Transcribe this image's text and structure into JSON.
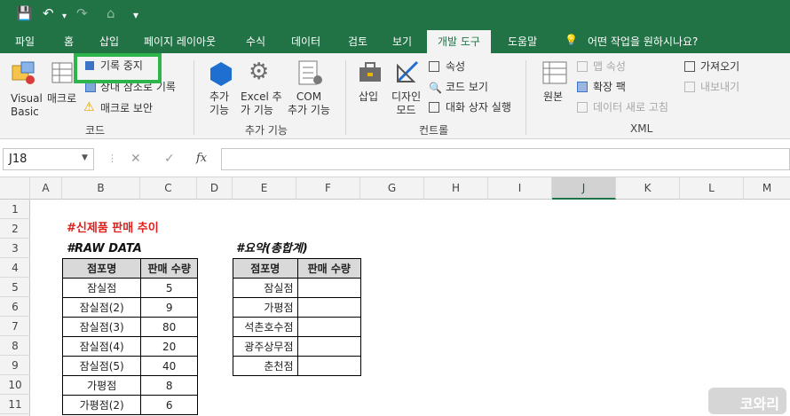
{
  "quick_access": {
    "save": "💾",
    "undo": "↶",
    "redo": "↷",
    "more": "⌂",
    "customize": "▾"
  },
  "tabs": [
    "파일",
    "홈",
    "삽입",
    "페이지 레이아웃",
    "수식",
    "데이터",
    "검토",
    "보기",
    "개발 도구",
    "도움말"
  ],
  "active_tab": "개발 도구",
  "tellme": "어떤 작업을 원하시나요?",
  "ribbon": {
    "code": {
      "visual_basic": [
        "Visual",
        "Basic"
      ],
      "macro": "매크로",
      "record_stop": "기록 중지",
      "relative_ref": "상대 참조로 기록",
      "macro_security": "매크로 보안",
      "group": "코드"
    },
    "addins": {
      "addins": [
        "추가",
        "기능"
      ],
      "excel_addins": [
        "Excel 추",
        "가 기능"
      ],
      "com_addins": [
        "COM",
        "추가 기능"
      ],
      "group": "추가 기능"
    },
    "controls": {
      "insert": [
        "삽입"
      ],
      "design_mode": [
        "디자인",
        "모드"
      ],
      "properties": "속성",
      "view_code": "코드 보기",
      "run_dialog": "대화 상자 실행",
      "group": "컨트롤"
    },
    "xml": {
      "source": "원본",
      "map_properties": "맵 속성",
      "expansion_packs": "확장 팩",
      "refresh_data": "데이터 새로 고침",
      "import": "가져오기",
      "export": "내보내기",
      "group": "XML"
    }
  },
  "name_box": "J18",
  "formula_icons": {
    "cancel": "✕",
    "enter": "✓",
    "fx": "fx"
  },
  "columns": [
    "A",
    "B",
    "C",
    "D",
    "E",
    "F",
    "G",
    "H",
    "I",
    "J",
    "K",
    "L",
    "M"
  ],
  "selected_column": "J",
  "rows": [
    "1",
    "2",
    "3",
    "4",
    "5",
    "6",
    "7",
    "8",
    "9",
    "10",
    "11"
  ],
  "sheet": {
    "title": "#신제품 판매 추이",
    "raw_title": "#RAW DATA",
    "summary_title": "#요약(총합계)",
    "raw_headers": [
      "점포명",
      "판매 수량"
    ],
    "raw_rows": [
      [
        "잠실점",
        "5"
      ],
      [
        "잠실점(2)",
        "9"
      ],
      [
        "잠실점(3)",
        "80"
      ],
      [
        "잠실점(4)",
        "20"
      ],
      [
        "잠실점(5)",
        "40"
      ],
      [
        "가평점",
        "8"
      ],
      [
        "가평점(2)",
        "6"
      ]
    ],
    "summary_headers": [
      "점포명",
      "판매 수량"
    ],
    "summary_rows": [
      [
        "잠실점",
        ""
      ],
      [
        "가평점",
        ""
      ],
      [
        "석촌호수점",
        ""
      ],
      [
        "광주상무점",
        ""
      ],
      [
        "춘천점",
        ""
      ]
    ]
  },
  "watermark": "코와리",
  "colors": {
    "excel_green": "#217346",
    "highlight": "#2db44a",
    "title_red": "#e0201c"
  }
}
